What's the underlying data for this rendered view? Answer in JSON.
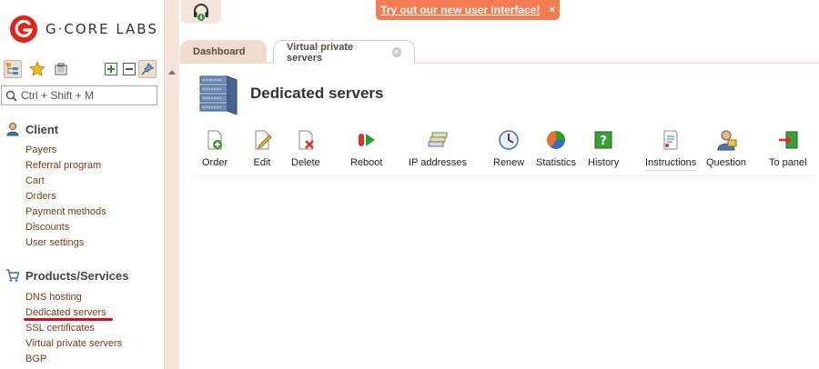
{
  "brand": {
    "name": "G·CORE LABS"
  },
  "promo": {
    "label": "Try out our new user interface!",
    "close": "×"
  },
  "search": {
    "placeholder": "Ctrl + Shift + M"
  },
  "sidebar": {
    "client": {
      "title": "Client",
      "items": [
        "Payers",
        "Referral program",
        "Cart",
        "Orders",
        "Payment methods",
        "Discounts",
        "User settings"
      ]
    },
    "products": {
      "title": "Products/Services",
      "items": [
        "DNS hosting",
        "Dedicated servers",
        "SSL certificates",
        "Virtual private servers",
        "BGP"
      ]
    }
  },
  "tabs": [
    {
      "label": "Dashboard"
    },
    {
      "label": "Virtual private servers"
    }
  ],
  "page": {
    "title": "Dedicated servers"
  },
  "toolbar": {
    "buttons": [
      {
        "label": "Order",
        "icon": "order-icon"
      },
      {
        "label": "Edit",
        "icon": "edit-icon"
      },
      {
        "label": "Delete",
        "icon": "delete-icon"
      },
      {
        "label": "Reboot",
        "icon": "reboot-icon"
      },
      {
        "label": "IP addresses",
        "icon": "ip-addresses-icon"
      },
      {
        "label": "Renew",
        "icon": "renew-icon"
      },
      {
        "label": "Statistics",
        "icon": "statistics-icon"
      },
      {
        "label": "History",
        "icon": "history-icon"
      },
      {
        "label": "Instructions",
        "icon": "instructions-icon"
      },
      {
        "label": "Question",
        "icon": "question-icon"
      },
      {
        "label": "To panel",
        "icon": "to-panel-icon"
      }
    ]
  },
  "colors": {
    "accent": "#f47b52",
    "link": "#7a3b1b",
    "panel": "#f5e6dc",
    "underline": "#d0101c"
  }
}
